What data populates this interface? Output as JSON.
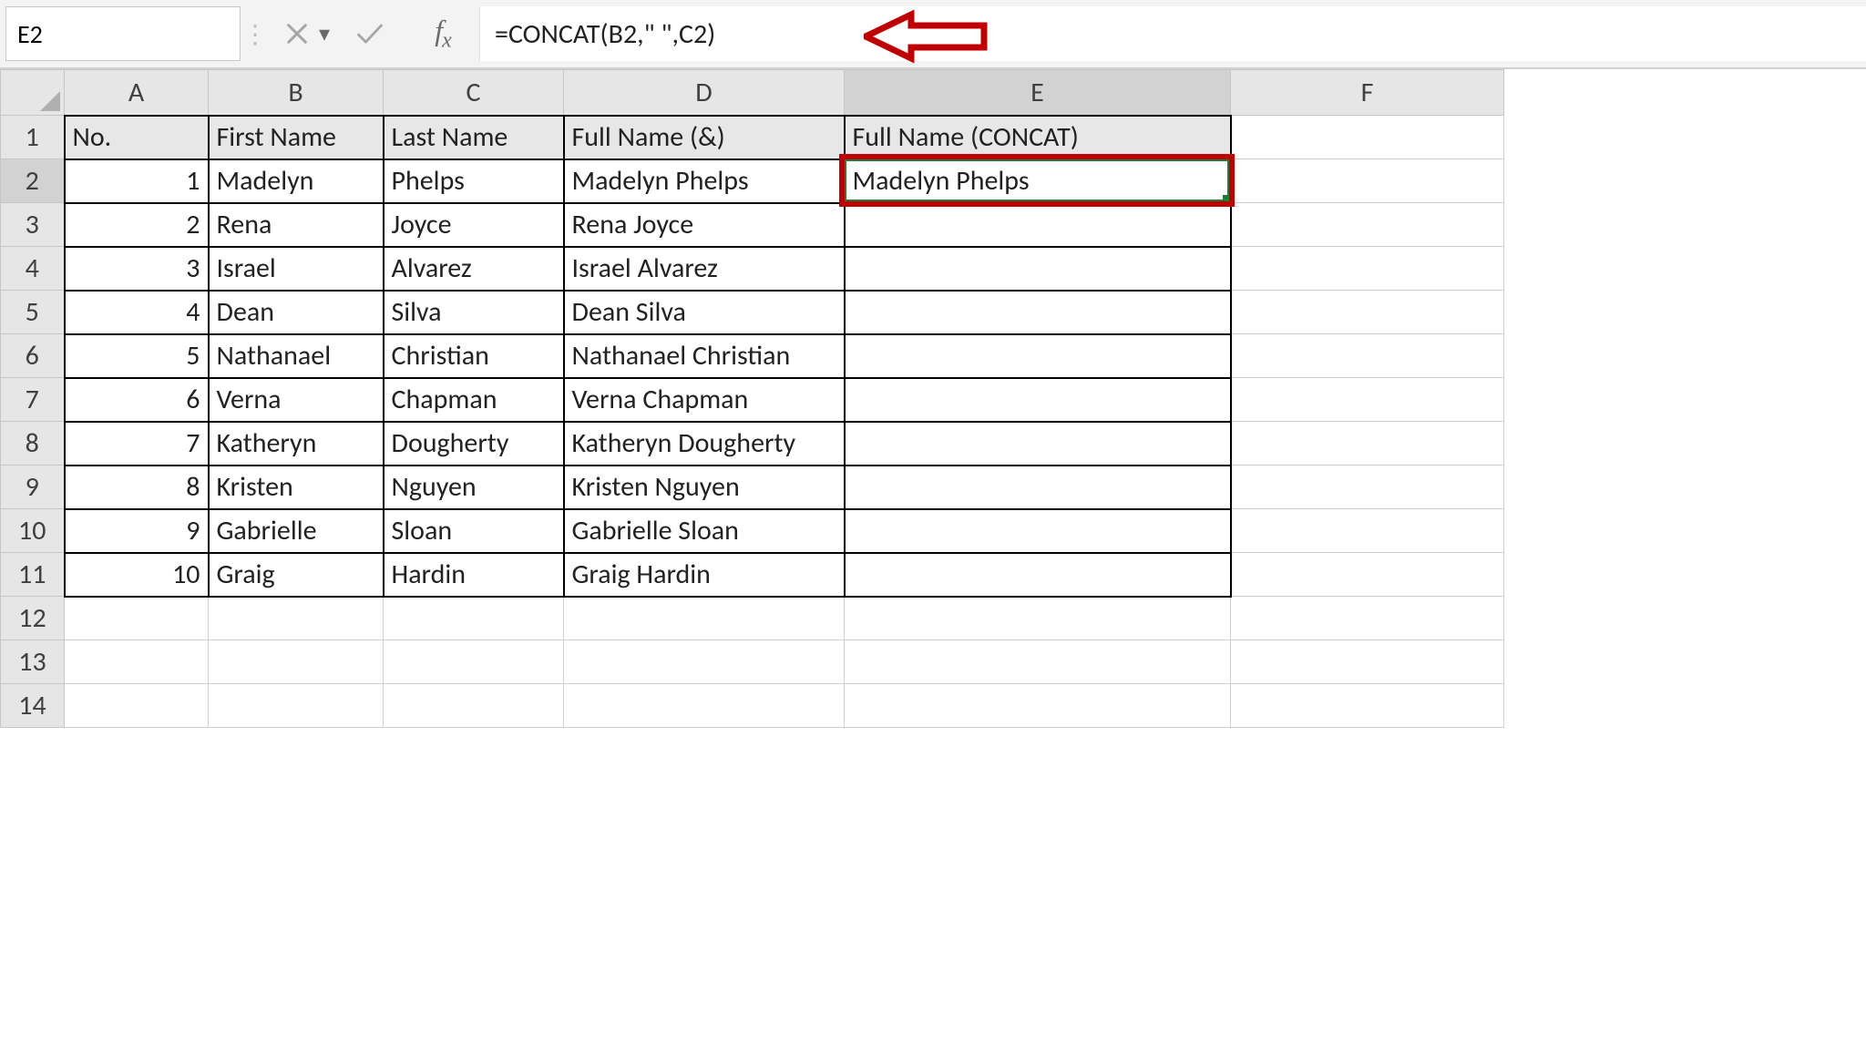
{
  "name_box": "E2",
  "formula": "=CONCAT(B2,\" \",C2)",
  "col_headers": [
    "A",
    "B",
    "C",
    "D",
    "E",
    "F"
  ],
  "selected_col": "E",
  "selected_row": 2,
  "visible_rows": 14,
  "table": {
    "header": {
      "A": "No.",
      "B": "First Name",
      "C": "Last Name",
      "D": "Full Name (&)",
      "E": "Full Name (CONCAT)"
    },
    "rows": [
      {
        "A": "1",
        "B": "Madelyn",
        "C": "Phelps",
        "D": "Madelyn Phelps",
        "E": "Madelyn Phelps"
      },
      {
        "A": "2",
        "B": "Rena",
        "C": "Joyce",
        "D": "Rena Joyce",
        "E": ""
      },
      {
        "A": "3",
        "B": "Israel",
        "C": "Alvarez",
        "D": "Israel Alvarez",
        "E": ""
      },
      {
        "A": "4",
        "B": "Dean",
        "C": "Silva",
        "D": "Dean Silva",
        "E": ""
      },
      {
        "A": "5",
        "B": "Nathanael",
        "C": "Christian",
        "D": "Nathanael Christian",
        "E": ""
      },
      {
        "A": "6",
        "B": "Verna",
        "C": "Chapman",
        "D": "Verna Chapman",
        "E": ""
      },
      {
        "A": "7",
        "B": "Katheryn",
        "C": "Dougherty",
        "D": "Katheryn Dougherty",
        "E": ""
      },
      {
        "A": "8",
        "B": "Kristen",
        "C": "Nguyen",
        "D": "Kristen Nguyen",
        "E": ""
      },
      {
        "A": "9",
        "B": "Gabrielle",
        "C": "Sloan",
        "D": "Gabrielle Sloan",
        "E": ""
      },
      {
        "A": "10",
        "B": "Graig",
        "C": "Hardin",
        "D": "Graig Hardin",
        "E": ""
      }
    ]
  }
}
